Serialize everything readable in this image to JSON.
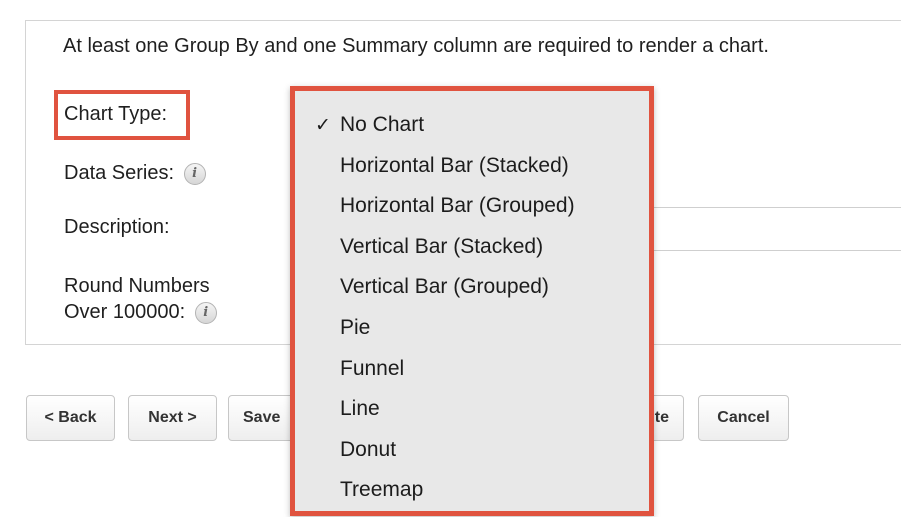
{
  "notice": "At least one Group By and one Summary column are required to render a chart.",
  "fields": {
    "chart_type_label": "Chart Type:",
    "data_series_label": "Data Series:",
    "description_label": "Description:",
    "round_numbers_line1": "Round Numbers",
    "round_numbers_line2": "Over 100000:",
    "info_glyph": "i"
  },
  "buttons": {
    "back": "< Back",
    "next": "Next >",
    "save": "Save",
    "save_run_partial": "te",
    "cancel": "Cancel"
  },
  "dropdown": {
    "selected_check": "✓",
    "options": [
      "No Chart",
      "Horizontal Bar (Stacked)",
      "Horizontal Bar (Grouped)",
      "Vertical Bar (Stacked)",
      "Vertical Bar (Grouped)",
      "Pie",
      "Funnel",
      "Line",
      "Donut",
      "Treemap"
    ],
    "selected": "No Chart"
  },
  "colors": {
    "highlight": "#e0533f",
    "dropdown_bg": "#e8e8e8"
  }
}
